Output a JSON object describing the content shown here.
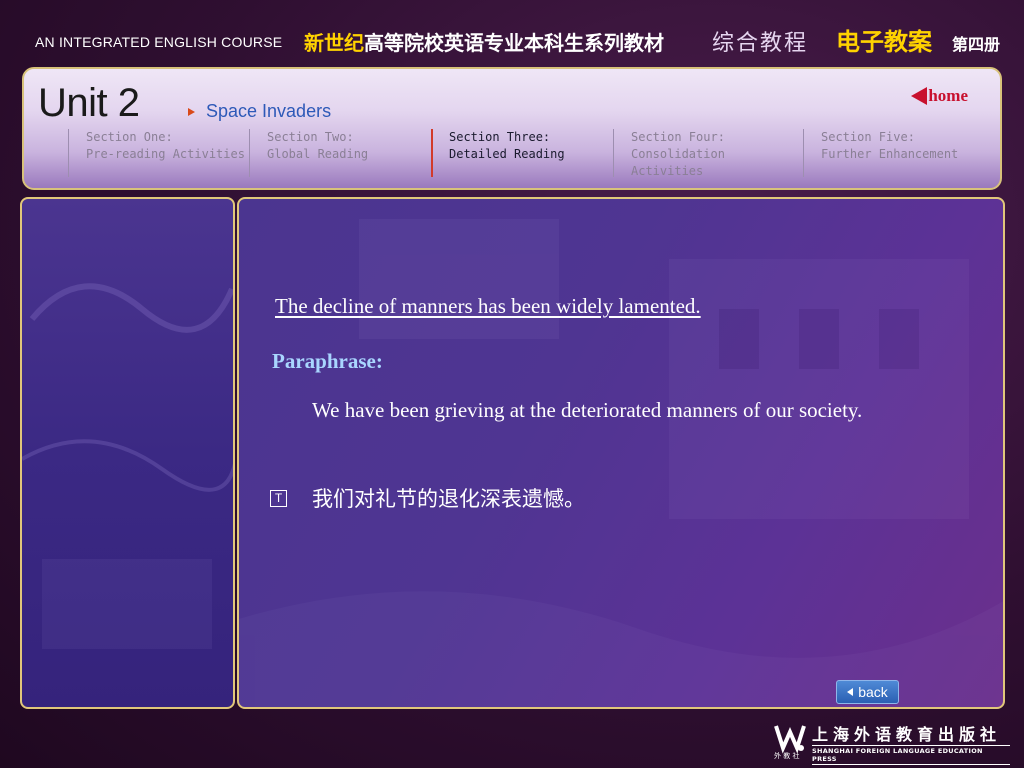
{
  "banner": {
    "course_name": "AN INTEGRATED ENGLISH COURSE",
    "series_highlight": "新世纪",
    "series_rest": "高等院校英语专业本科生系列教材",
    "book_name": "综合教程",
    "e_plan": "电子教案",
    "volume": "第四册"
  },
  "header": {
    "unit_title": "Unit 2",
    "unit_subtitle": "Space Invaders",
    "home_label": "home",
    "sections": [
      {
        "line1": "Section One:",
        "line2": "Pre-reading Activities",
        "active": false
      },
      {
        "line1": "Section Two:",
        "line2": "Global Reading",
        "active": false
      },
      {
        "line1": "Section Three:",
        "line2": "Detailed Reading",
        "active": true
      },
      {
        "line1": "Section Four:",
        "line2": "Consolidation Activities",
        "active": false
      },
      {
        "line1": "Section Five:",
        "line2": "Further Enhancement",
        "active": false
      }
    ]
  },
  "content": {
    "sentence": "The decline of manners has been widely lamented.",
    "paraphrase_label": "Paraphrase:",
    "paraphrase_text": "We have been grieving at the deteriorated manners of our society.",
    "translate_icon": "T",
    "translation": "我们对礼节的退化深表遗憾。",
    "back_label": "back"
  },
  "footer": {
    "publisher_cn": "上海外语教育出版社",
    "publisher_en": "SHANGHAI FOREIGN LANGUAGE EDUCATION PRESS",
    "logo_sub": "外 教 社"
  },
  "colors": {
    "accent_yellow": "#ffd200",
    "home_red": "#c8102e",
    "paraphrase_blue": "#a9d6ff",
    "panel_border_gold": "#e1c77a"
  }
}
